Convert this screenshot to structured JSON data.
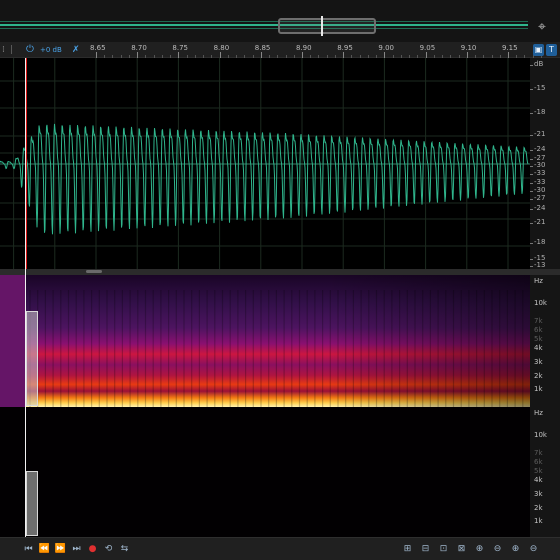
{
  "overview": {
    "tool_icon": "⌖"
  },
  "ruler": {
    "zoom_icon": "⏻",
    "gain_label": "+0 dB",
    "snap_icon": "✗",
    "time_ticks": [
      "8.65",
      "8.70",
      "8.75",
      "8.80",
      "8.85",
      "8.90",
      "8.95",
      "9.00",
      "9.05",
      "9.10",
      "9.15"
    ],
    "right_buttons": [
      "▣",
      "T"
    ]
  },
  "waveform": {
    "color": "#2fb58c",
    "db_labels": [
      "dB",
      "-15",
      "-18",
      "-21",
      "-24",
      "-27",
      "-30",
      "-33",
      "-33",
      "-30",
      "-27",
      "-24",
      "-21",
      "-18",
      "-15",
      "-13"
    ]
  },
  "spectrogram": {
    "unit": "Hz",
    "labels": [
      {
        "text": "Hz",
        "dim": false
      },
      {
        "text": "10k",
        "dim": false
      },
      {
        "text": "7k",
        "dim": true
      },
      {
        "text": "6k",
        "dim": true
      },
      {
        "text": "5k",
        "dim": true
      },
      {
        "text": "4k",
        "dim": false
      },
      {
        "text": "3k",
        "dim": false
      },
      {
        "text": "2k",
        "dim": false
      },
      {
        "text": "1k",
        "dim": false
      }
    ]
  },
  "spectrogram2": {
    "labels": [
      {
        "text": "Hz",
        "dim": false
      },
      {
        "text": "10k",
        "dim": false
      },
      {
        "text": "7k",
        "dim": true
      },
      {
        "text": "6k",
        "dim": true
      },
      {
        "text": "5k",
        "dim": true
      },
      {
        "text": "4k",
        "dim": false
      },
      {
        "text": "3k",
        "dim": false
      },
      {
        "text": "2k",
        "dim": false
      },
      {
        "text": "1k",
        "dim": false
      }
    ]
  },
  "transport": {
    "left_buttons": [
      {
        "name": "go-to-start-button",
        "glyph": "⏮"
      },
      {
        "name": "rewind-button",
        "glyph": "⏪"
      },
      {
        "name": "fast-forward-button",
        "glyph": "⏩"
      },
      {
        "name": "go-to-end-button",
        "glyph": "⏭"
      },
      {
        "name": "record-button",
        "glyph": "●"
      },
      {
        "name": "loop-button",
        "glyph": "⟲"
      },
      {
        "name": "skip-selection-button",
        "glyph": "⇆"
      }
    ],
    "right_buttons": [
      {
        "name": "zoom-in-amplitude-button",
        "glyph": "⊞"
      },
      {
        "name": "zoom-out-amplitude-button",
        "glyph": "⊟"
      },
      {
        "name": "zoom-in-selection-button",
        "glyph": "⊡"
      },
      {
        "name": "zoom-full-button",
        "glyph": "⊠"
      },
      {
        "name": "zoom-in-time-button",
        "glyph": "⊕"
      },
      {
        "name": "zoom-out-time-button",
        "glyph": "⊖"
      },
      {
        "name": "zoom-in-point-button",
        "glyph": "⊕"
      },
      {
        "name": "zoom-out-point-button",
        "glyph": "⊖"
      }
    ]
  }
}
